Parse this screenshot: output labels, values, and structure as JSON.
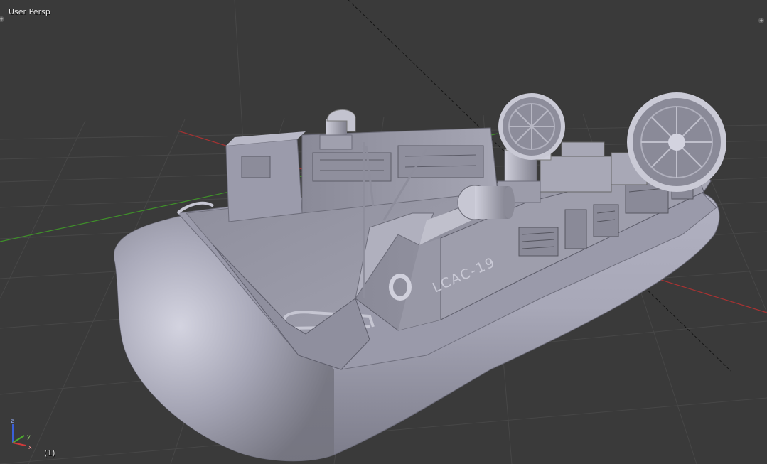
{
  "viewport": {
    "view_name": "User Persp",
    "frame_indicator": "(1)",
    "hull_marking": "LCAC-19"
  },
  "gizmo": {
    "z_label": "z",
    "y_label": "y",
    "x_label": "x"
  },
  "colors": {
    "background": "#3a3a3a",
    "grid": "#484848",
    "x_axis": "#a83232",
    "y_axis": "#3f8f2a",
    "model_base": "#a4a4b4",
    "model_shadow": "#5e5e6c"
  }
}
